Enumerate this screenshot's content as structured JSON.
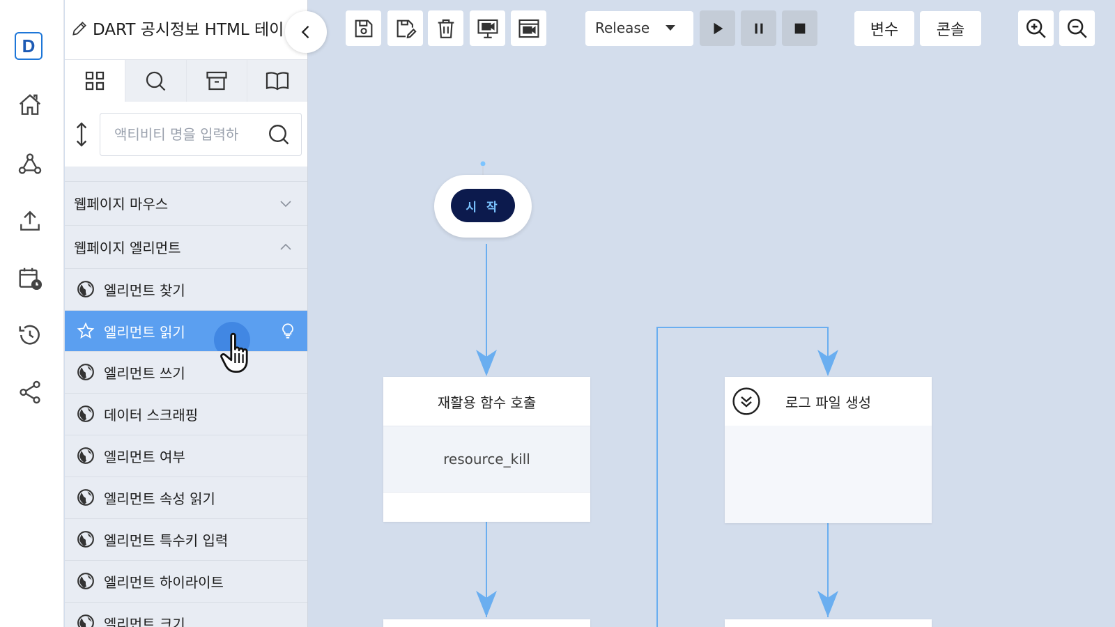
{
  "app": {
    "logo_letter": "D",
    "project_title": "DART 공시정보 HTML 테이"
  },
  "rail": {
    "items": [
      "home-icon",
      "webhook-icon",
      "upload-icon",
      "schedule-icon",
      "history-icon",
      "share-icon"
    ]
  },
  "panel": {
    "tabs": [
      "grid-icon",
      "search-icon",
      "archive-icon",
      "book-icon"
    ],
    "search_placeholder": "액티비티 명을 입력하",
    "groups": [
      {
        "label": "웹페이지 마우스",
        "expanded": false
      },
      {
        "label": "웹페이지 엘리먼트",
        "expanded": true
      }
    ],
    "items": [
      {
        "label": "엘리먼트 찾기",
        "icon": "globe-icon"
      },
      {
        "label": "엘리먼트 읽기",
        "icon": "star-icon",
        "selected": true
      },
      {
        "label": "엘리먼트 쓰기",
        "icon": "globe-icon"
      },
      {
        "label": "데이터 스크래핑",
        "icon": "globe-icon"
      },
      {
        "label": "엘리먼트 여부",
        "icon": "globe-icon"
      },
      {
        "label": "엘리먼트 속성 읽기",
        "icon": "globe-icon"
      },
      {
        "label": "엘리먼트 특수키 입력",
        "icon": "globe-icon"
      },
      {
        "label": "엘리먼트 하이라이트",
        "icon": "globe-icon"
      },
      {
        "label": "엘리먼트 크기",
        "icon": "globe-icon"
      }
    ]
  },
  "toolbar": {
    "file_buttons": [
      "save-icon",
      "save-as-icon",
      "delete-icon",
      "screen-record-icon",
      "window-record-icon"
    ],
    "mode_select": "Release",
    "run_buttons": [
      "play-icon",
      "pause-icon",
      "stop-icon"
    ],
    "variables_label": "변수",
    "console_label": "콘솔",
    "zoom_buttons": [
      "zoom-in-icon",
      "zoom-out-icon"
    ]
  },
  "canvas": {
    "start_label": "시 작",
    "nodes": [
      {
        "title": "재활용 함수 호출",
        "body": "resource_kill"
      },
      {
        "title": "로그 파일 생성",
        "body": ""
      }
    ]
  },
  "colors": {
    "accent": "#5b9ff0",
    "canvas_bg": "#d3ddec",
    "wire": "#6aaef0",
    "start_pill": "#0c1a4d"
  }
}
